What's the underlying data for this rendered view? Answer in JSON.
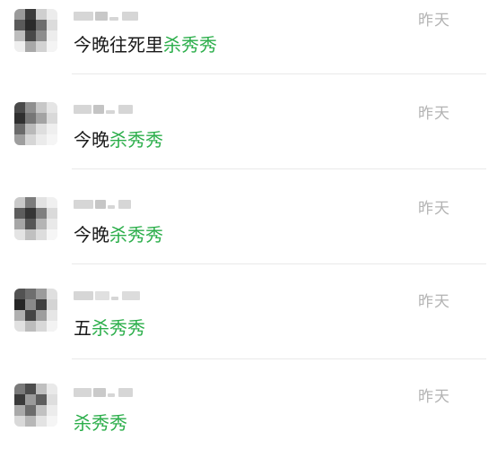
{
  "colors": {
    "highlight": "#2bae4a",
    "text": "#1a1a1a",
    "time": "#b3b3b3",
    "divider": "#e9e9e9"
  },
  "chats": [
    {
      "name": "(blurred)",
      "time": "昨天",
      "message_prefix": "今晚往死里",
      "message_highlight": "杀秀秀"
    },
    {
      "name": "(blurred)",
      "time": "昨天",
      "message_prefix": "今晚",
      "message_highlight": "杀秀秀"
    },
    {
      "name": "(blurred)",
      "time": "昨天",
      "message_prefix": "今晚",
      "message_highlight": "杀秀秀"
    },
    {
      "name": "(blurred)",
      "time": "昨天",
      "message_prefix": "五",
      "message_highlight": "杀秀秀"
    },
    {
      "name": "(blurred)",
      "time": "昨天",
      "message_prefix": "",
      "message_highlight": "杀秀秀"
    }
  ]
}
